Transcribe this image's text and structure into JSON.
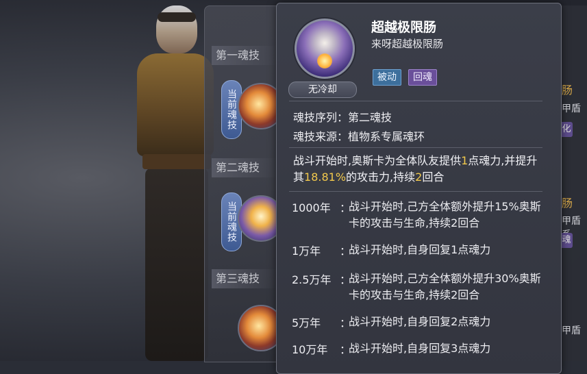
{
  "left_panel": {
    "slots": [
      {
        "label": "第一魂技"
      },
      {
        "label": "第二魂技"
      },
      {
        "label": "第三魂技"
      }
    ],
    "current_tag": "当前魂技"
  },
  "tooltip": {
    "cooldown": "无冷却",
    "title": "超越极限肠",
    "subtitle": "来呀超越极限肠",
    "tags": [
      "被动",
      "回魂"
    ],
    "sequence_label": "魂技序列：",
    "sequence_value": "第二魂技",
    "source_label": "魂技来源：",
    "source_value": "植物系专属魂环",
    "desc": {
      "p1": "战斗开始时,奥斯卡为全体队友提供",
      "v1": "1",
      "p2": "点魂力,并提升其",
      "v2": "18.81%",
      "p3": "的攻击力,持续",
      "v3": "2",
      "p4": "回合"
    },
    "levels": [
      {
        "year": "1000年",
        "colon": "：",
        "text": "战斗开始时,己方全体额外提升15%奥斯卡的攻击与生命,持续2回合"
      },
      {
        "year": "1万年",
        "colon": "：",
        "text": "战斗开始时,自身回复1点魂力"
      },
      {
        "year": "2.5万年",
        "colon": "：",
        "text": "战斗开始时,己方全体额外提升30%奥斯卡的攻击与生命,持续2回合"
      },
      {
        "year": "5万年",
        "colon": "：",
        "text": "战斗开始时,自身回复2点魂力"
      },
      {
        "year": "10万年",
        "colon": "：",
        "text": "战斗开始时,自身回复3点魂力"
      }
    ]
  },
  "right_partial": {
    "items": [
      {
        "text": "肠"
      },
      {
        "text": "甲盾"
      },
      {
        "text": "化"
      },
      {
        "text": "肠"
      },
      {
        "text": "甲盾系"
      },
      {
        "text": "魂"
      },
      {
        "text": "甲盾"
      }
    ]
  }
}
